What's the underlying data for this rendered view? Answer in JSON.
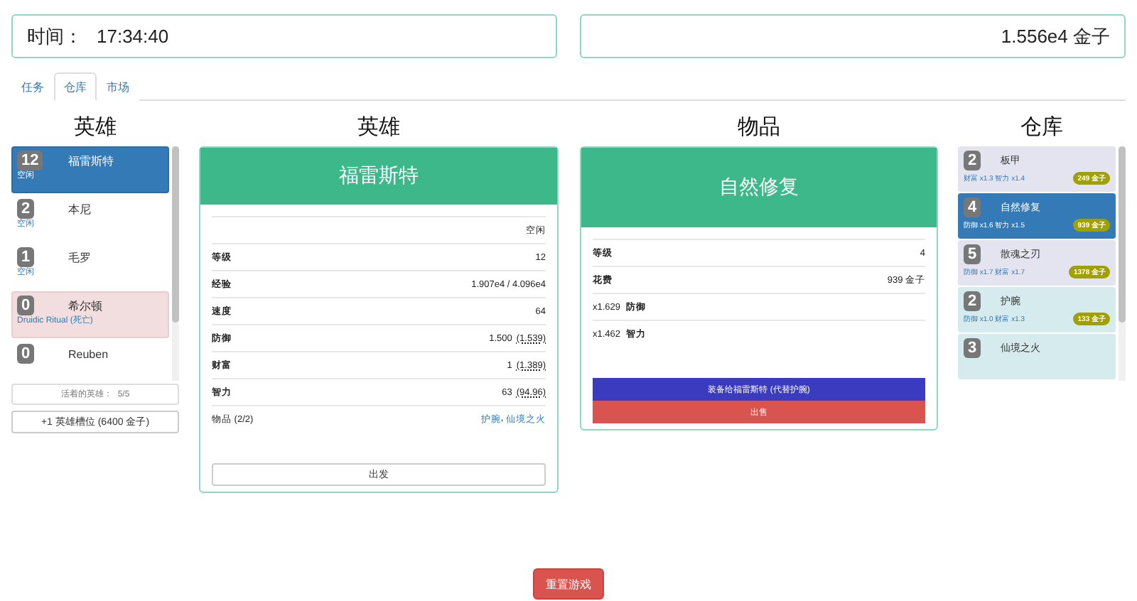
{
  "time_box": {
    "label": "时间：",
    "value": "17:34:40"
  },
  "gold_box": {
    "value": "1.556e4 金子"
  },
  "tabs": [
    {
      "label": "任务",
      "selected": false
    },
    {
      "label": "仓库",
      "selected": true
    },
    {
      "label": "市场",
      "selected": false
    }
  ],
  "hero_list": {
    "title": "英雄",
    "heroes": [
      {
        "level": "12",
        "name": "福雷斯特",
        "status": "空闲",
        "selected": true,
        "dead": false
      },
      {
        "level": "2",
        "name": "本尼",
        "status": "空闲",
        "selected": false,
        "dead": false
      },
      {
        "level": "1",
        "name": "毛罗",
        "status": "空闲",
        "selected": false,
        "dead": false
      },
      {
        "level": "0",
        "name": "希尔顿",
        "status": "Druidic Ritual (死亡)",
        "selected": false,
        "dead": true
      },
      {
        "level": "0",
        "name": "Reuben",
        "selected": false,
        "dead": false
      }
    ],
    "alive_label": "活着的英雄：",
    "alive_count": "5/5",
    "add_slot_button": "+1 英雄槽位 (6400 金子)"
  },
  "hero_panel": {
    "title": "英雄",
    "name": "福雷斯特",
    "status": "空闲",
    "stats": [
      {
        "label": "等级",
        "value": "12"
      },
      {
        "label": "经验",
        "value": "1.907e4 / 4.096e4"
      },
      {
        "label": "速度",
        "value": "64"
      },
      {
        "label": "防御",
        "value": "1.500",
        "detail": "(1.539)"
      },
      {
        "label": "财富",
        "value": "1",
        "detail": "(1.389)"
      },
      {
        "label": "智力",
        "value": "63",
        "detail": "(94.96)"
      }
    ],
    "items_label": "物品 (2/2)",
    "items": [
      "护腕",
      "仙境之火"
    ],
    "item_separator": ", ",
    "depart_button": "出发"
  },
  "item_panel": {
    "title": "物品",
    "name": "自然修复",
    "stats": [
      {
        "label": "等级",
        "value": "4"
      },
      {
        "label": "花费",
        "value": "939 金子"
      }
    ],
    "bonuses": [
      {
        "value": "x1.629",
        "label": "防御"
      },
      {
        "value": "x1.462",
        "label": "智力"
      }
    ],
    "equip_button": "装备给福雷斯特 (代替护腕)",
    "sell_button": "出售"
  },
  "warehouse": {
    "title": "仓库",
    "items": [
      {
        "level": "2",
        "name": "板甲",
        "bonus": "财富 x1.3 智力 x1.4",
        "price": "249 金子",
        "selected": false,
        "equipped": false
      },
      {
        "level": "4",
        "name": "自然修复",
        "bonus": "防御 x1.6 智力 x1.5",
        "price": "939 金子",
        "selected": true,
        "equipped": false
      },
      {
        "level": "5",
        "name": "散魂之刃",
        "bonus": "防御 x1.7 财富 x1.7",
        "price": "1378 金子",
        "selected": false,
        "equipped": false
      },
      {
        "level": "2",
        "name": "护腕",
        "bonus": "防御 x1.0 财富 x1.3",
        "price": "133 金子",
        "selected": false,
        "equipped": true
      },
      {
        "level": "3",
        "name": "仙境之火",
        "selected": false,
        "equipped": true
      }
    ]
  },
  "reset_button": "重置游戏"
}
